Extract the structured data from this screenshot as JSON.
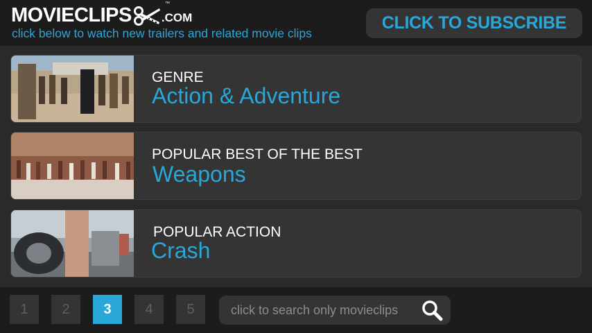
{
  "header": {
    "logo_word": "MOVIECLIPS",
    "logo_tm": "™",
    "logo_suffix": ".COM",
    "tagline": "click below to watch new trailers and related movie clips",
    "subscribe_label": "CLICK TO SUBSCRIBE"
  },
  "cards": [
    {
      "subtitle": "GENRE",
      "title": "Action & Adventure"
    },
    {
      "subtitle": "POPULAR BEST OF THE BEST",
      "title": "Weapons"
    },
    {
      "subtitle": "POPULAR ACTION",
      "title": "Crash"
    }
  ],
  "pagination": {
    "pages": [
      "1",
      "2",
      "3",
      "4",
      "5"
    ],
    "current": "3"
  },
  "search": {
    "placeholder": "click to search only movieclips"
  },
  "colors": {
    "accent": "#2aa7d9",
    "background": "#2a2a2b",
    "bar": "#1c1c1d",
    "card": "#343435"
  }
}
